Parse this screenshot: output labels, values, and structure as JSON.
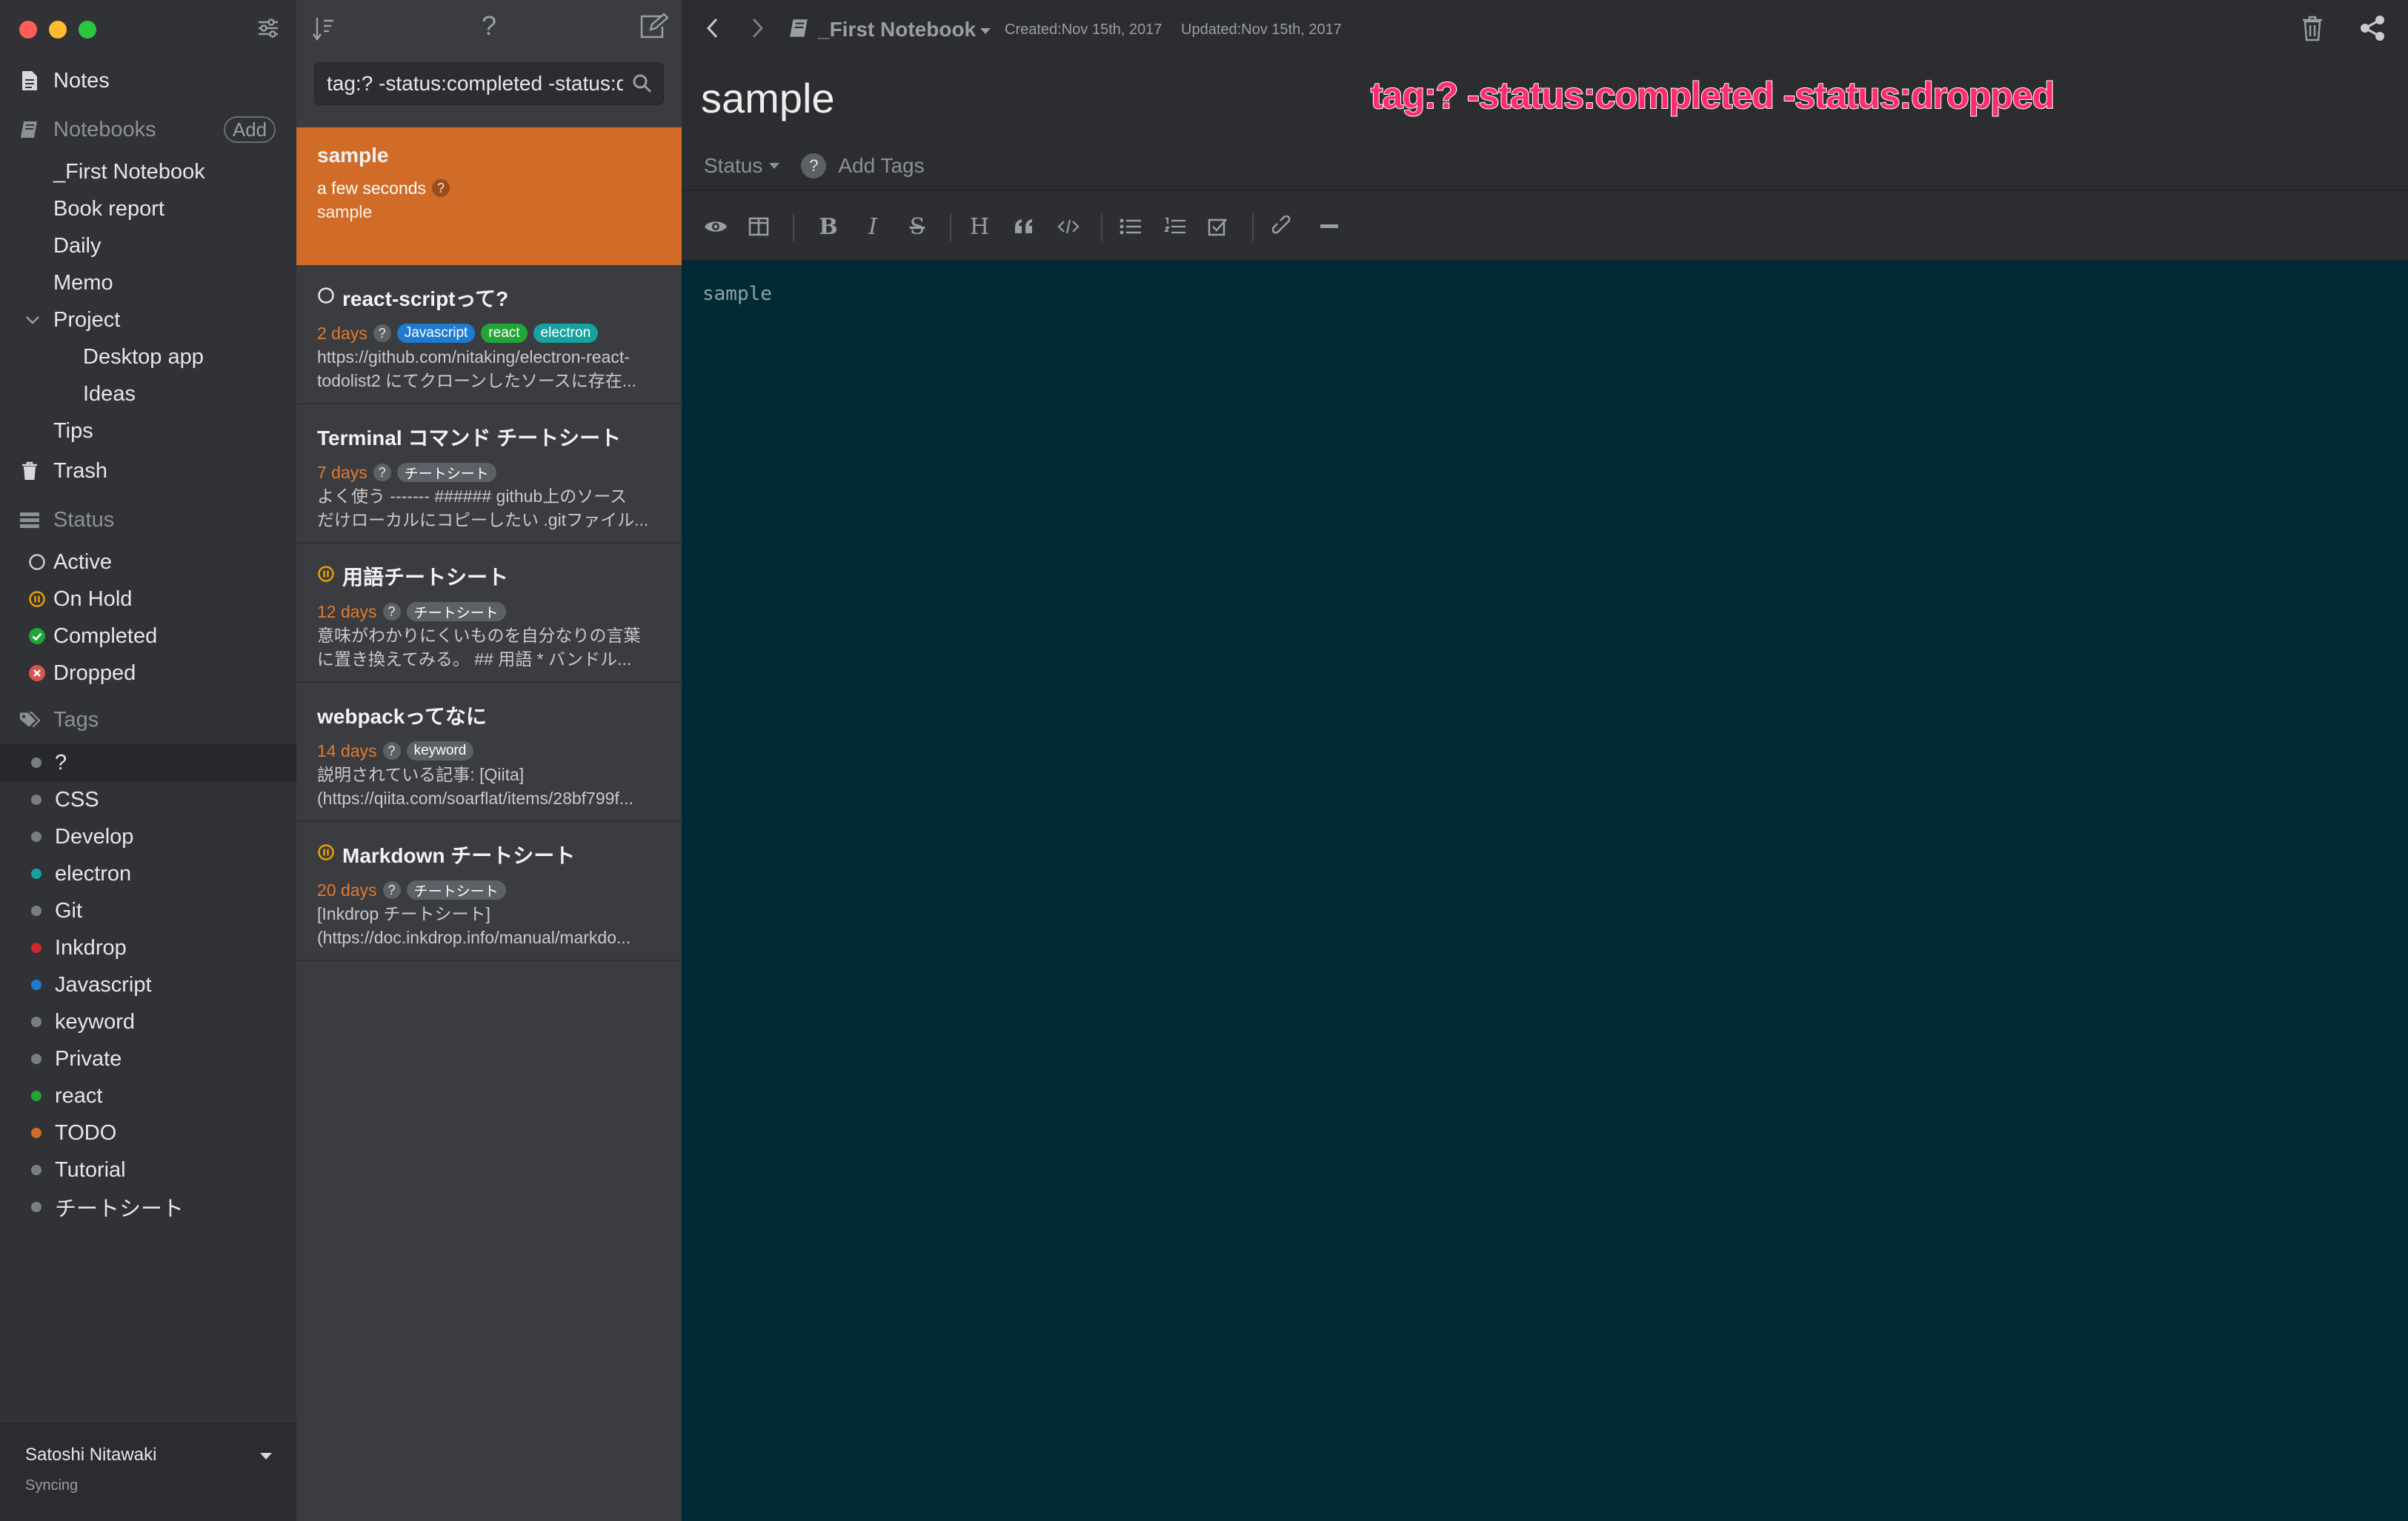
{
  "colors": {
    "traffic_close": "#ff5f57",
    "traffic_min": "#febc2e",
    "traffic_max": "#28c840",
    "accent": "#d06c28",
    "editor_bg": "#002b36"
  },
  "sidebar": {
    "notes": "Notes",
    "notebooks_header": "Notebooks",
    "add_label": "Add",
    "notebooks": [
      "_First Notebook",
      "Book report",
      "Daily",
      "Memo",
      "Project",
      "Desktop app",
      "Ideas",
      "Tips"
    ],
    "trash": "Trash",
    "status_header": "Status",
    "statuses": [
      "Active",
      "On Hold",
      "Completed",
      "Dropped"
    ],
    "tags_header": "Tags",
    "tags": [
      {
        "name": "?",
        "color": "#7a7d83"
      },
      {
        "name": "CSS",
        "color": "#7a7d83"
      },
      {
        "name": "Develop",
        "color": "#7a7d83"
      },
      {
        "name": "electron",
        "color": "#17a2a0"
      },
      {
        "name": "Git",
        "color": "#7a7d83"
      },
      {
        "name": "Inkdrop",
        "color": "#d0262d"
      },
      {
        "name": "Javascript",
        "color": "#1e7bd0"
      },
      {
        "name": "keyword",
        "color": "#7a7d83"
      },
      {
        "name": "Private",
        "color": "#7a7d83"
      },
      {
        "name": "react",
        "color": "#21a636"
      },
      {
        "name": "TODO",
        "color": "#d06c28"
      },
      {
        "name": "Tutorial",
        "color": "#7a7d83"
      },
      {
        "name": "チートシート",
        "color": "#7a7d83"
      }
    ],
    "user": "Satoshi Nitawaki",
    "sync_status": "Syncing"
  },
  "notelist": {
    "search_value": "tag:? -status:completed -status:dropped",
    "help_label": "?",
    "notes": [
      {
        "title": "sample",
        "days": "a few seconds",
        "tags": [],
        "body1": "sample",
        "body2": ""
      },
      {
        "title": "react-scriptって?",
        "days": "2 days",
        "tags": [
          {
            "label": "Javascript",
            "color": "#1e7bd0"
          },
          {
            "label": "react",
            "color": "#21a636"
          },
          {
            "label": "electron",
            "color": "#17a2a0"
          }
        ],
        "body1": "https://github.com/nitaking/electron-react-",
        "body2": "todolist2 にてクローンしたソースに存在..."
      },
      {
        "title": "Terminal コマンド チートシート",
        "days": "7 days",
        "tags": [
          {
            "label": "チートシート",
            "color": "#5d6066"
          }
        ],
        "body1": "よく使う ------- ###### github上のソース",
        "body2": "だけローカルにコピーしたい .gitファイル..."
      },
      {
        "title": "用語チートシート",
        "days": "12 days",
        "tags": [
          {
            "label": "チートシート",
            "color": "#5d6066"
          }
        ],
        "body1": "意味がわかりにくいものを自分なりの言葉",
        "body2": "に置き換えてみる。 ## 用語 * バンドル..."
      },
      {
        "title": "webpackってなに",
        "days": "14 days",
        "tags": [
          {
            "label": "keyword",
            "color": "#5d6066"
          }
        ],
        "body1": "説明されている記事: [Qiita]",
        "body2": "(https://qiita.com/soarflat/items/28bf799f..."
      },
      {
        "title": "Markdown チートシート",
        "days": "20 days",
        "tags": [
          {
            "label": "チートシート",
            "color": "#5d6066"
          }
        ],
        "body1": "[Inkdrop チートシート]",
        "body2": "(https://doc.inkdrop.info/manual/markdo..."
      }
    ]
  },
  "editor": {
    "notebook": "_First Notebook",
    "created": "Created:Nov 15th, 2017",
    "updated": "Updated:Nov 15th, 2017",
    "title": "sample",
    "annotation": "tag:? -status:completed -status:dropped",
    "status_label": "Status",
    "add_tags": "Add Tags",
    "content": "sample"
  }
}
